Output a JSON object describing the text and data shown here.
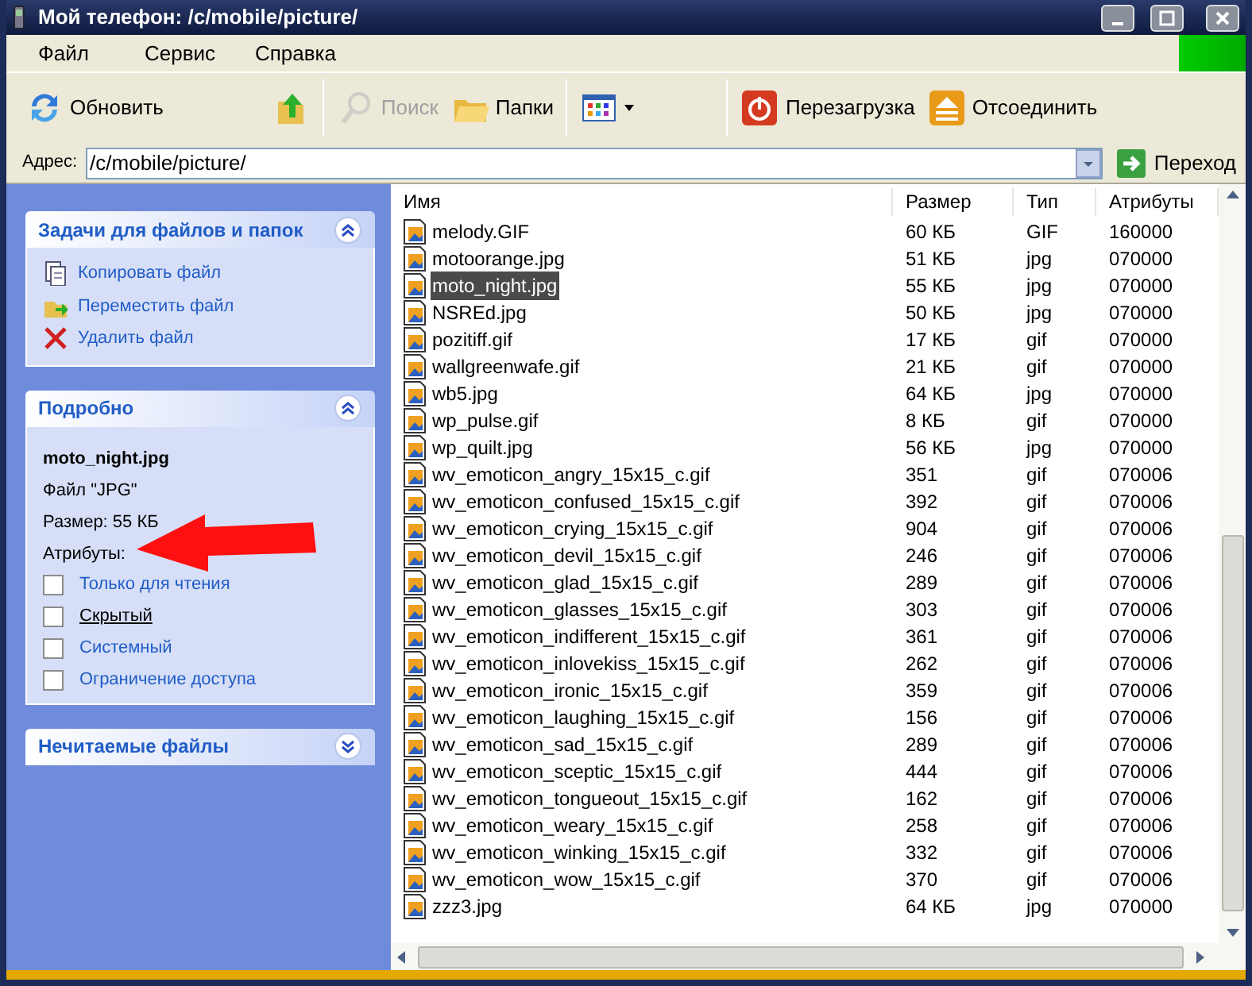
{
  "window": {
    "title": "Мой телефон: /c/mobile/picture/"
  },
  "menu": [
    "Файл",
    "Сервис",
    "Справка"
  ],
  "toolbar": [
    {
      "kind": "refresh",
      "label": "Обновить",
      "disabled": false
    },
    {
      "kind": "up",
      "disabled": false
    },
    {
      "kind": "search",
      "label": "Поиск",
      "disabled": true
    },
    {
      "kind": "folders",
      "label": "Папки",
      "disabled": false
    },
    {
      "kind": "views",
      "disabled": false
    },
    {
      "kind": "reboot",
      "label": "Перезагрузка",
      "disabled": false
    },
    {
      "kind": "eject",
      "label": "Отсоединить",
      "disabled": false
    }
  ],
  "address": {
    "label": "Адрес:",
    "value": "/c/mobile/picture/",
    "go": "Переход"
  },
  "sidebar": {
    "tasks": {
      "title": "Задачи для файлов и папок",
      "expanded": true,
      "items": [
        {
          "kind": "copy",
          "label": "Копировать файл"
        },
        {
          "kind": "move",
          "label": "Переместить файл"
        },
        {
          "kind": "delete",
          "label": "Удалить файл"
        }
      ]
    },
    "details": {
      "title": "Подробно",
      "expanded": true,
      "name": "moto_night.jpg",
      "type": "Файл \"JPG\"",
      "size": "Размер: 55 КБ",
      "attributes_label": "Атрибуты:",
      "attributes": [
        {
          "label": "Только для чтения",
          "checked": false,
          "hover": false
        },
        {
          "label": "Скрытый",
          "checked": false,
          "hover": true
        },
        {
          "label": "Системный",
          "checked": false,
          "hover": false
        },
        {
          "label": "Ограничение доступа",
          "checked": false,
          "hover": false
        }
      ]
    },
    "unreadable": {
      "title": "Нечитаемые файлы",
      "expanded": false
    }
  },
  "table": {
    "columns": [
      "Имя",
      "Размер",
      "Тип",
      "Атрибуты"
    ],
    "rows": [
      {
        "cells": [
          "melody.GIF",
          "60 КБ",
          "GIF",
          "160000"
        ],
        "selected": false
      },
      {
        "cells": [
          "motoorange.jpg",
          "51 КБ",
          "jpg",
          "070000"
        ],
        "selected": false
      },
      {
        "cells": [
          "moto_night.jpg",
          "55 КБ",
          "jpg",
          "070000"
        ],
        "selected": true
      },
      {
        "cells": [
          "NSREd.jpg",
          "50 КБ",
          "jpg",
          "070000"
        ],
        "selected": false
      },
      {
        "cells": [
          "pozitiff.gif",
          "17 КБ",
          "gif",
          "070000"
        ],
        "selected": false
      },
      {
        "cells": [
          "wallgreenwafe.gif",
          "21 КБ",
          "gif",
          "070000"
        ],
        "selected": false
      },
      {
        "cells": [
          "wb5.jpg",
          "64 КБ",
          "jpg",
          "070000"
        ],
        "selected": false
      },
      {
        "cells": [
          "wp_pulse.gif",
          "8 КБ",
          "gif",
          "070000"
        ],
        "selected": false
      },
      {
        "cells": [
          "wp_quilt.jpg",
          "56 КБ",
          "jpg",
          "070000"
        ],
        "selected": false
      },
      {
        "cells": [
          "wv_emoticon_angry_15x15_c.gif",
          "351",
          "gif",
          "070006"
        ],
        "selected": false
      },
      {
        "cells": [
          "wv_emoticon_confused_15x15_c.gif",
          "392",
          "gif",
          "070006"
        ],
        "selected": false
      },
      {
        "cells": [
          "wv_emoticon_crying_15x15_c.gif",
          "904",
          "gif",
          "070006"
        ],
        "selected": false
      },
      {
        "cells": [
          "wv_emoticon_devil_15x15_c.gif",
          "246",
          "gif",
          "070006"
        ],
        "selected": false
      },
      {
        "cells": [
          "wv_emoticon_glad_15x15_c.gif",
          "289",
          "gif",
          "070006"
        ],
        "selected": false
      },
      {
        "cells": [
          "wv_emoticon_glasses_15x15_c.gif",
          "303",
          "gif",
          "070006"
        ],
        "selected": false
      },
      {
        "cells": [
          "wv_emoticon_indifferent_15x15_c.gif",
          "361",
          "gif",
          "070006"
        ],
        "selected": false
      },
      {
        "cells": [
          "wv_emoticon_inlovekiss_15x15_c.gif",
          "262",
          "gif",
          "070006"
        ],
        "selected": false
      },
      {
        "cells": [
          "wv_emoticon_ironic_15x15_c.gif",
          "359",
          "gif",
          "070006"
        ],
        "selected": false
      },
      {
        "cells": [
          "wv_emoticon_laughing_15x15_c.gif",
          "156",
          "gif",
          "070006"
        ],
        "selected": false
      },
      {
        "cells": [
          "wv_emoticon_sad_15x15_c.gif",
          "289",
          "gif",
          "070006"
        ],
        "selected": false
      },
      {
        "cells": [
          "wv_emoticon_sceptic_15x15_c.gif",
          "444",
          "gif",
          "070006"
        ],
        "selected": false
      },
      {
        "cells": [
          "wv_emoticon_tongueout_15x15_c.gif",
          "162",
          "gif",
          "070006"
        ],
        "selected": false
      },
      {
        "cells": [
          "wv_emoticon_weary_15x15_c.gif",
          "258",
          "gif",
          "070006"
        ],
        "selected": false
      },
      {
        "cells": [
          "wv_emoticon_winking_15x15_c.gif",
          "332",
          "gif",
          "070006"
        ],
        "selected": false
      },
      {
        "cells": [
          "wv_emoticon_wow_15x15_c.gif",
          "370",
          "gif",
          "070006"
        ],
        "selected": false
      },
      {
        "cells": [
          "zzz3.jpg",
          "64 КБ",
          "jpg",
          "070000"
        ],
        "selected": false
      }
    ]
  }
}
